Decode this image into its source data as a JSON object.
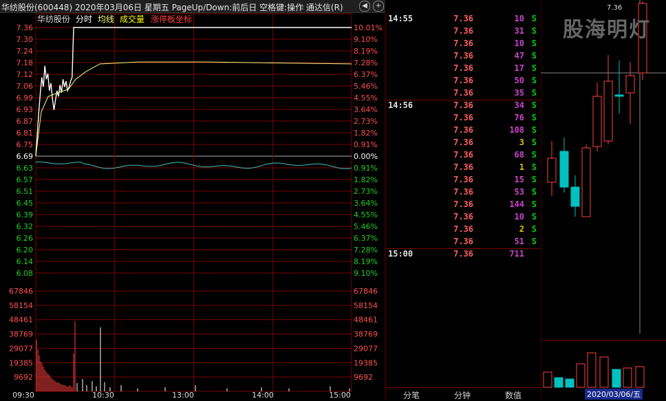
{
  "window": {
    "title": "华纺股份(600448)  2020年03月06日 星期五 PageUp/Down:前后日 空格键:操作 通达信(R)"
  },
  "legend": {
    "stock": "华纺股份",
    "items": [
      "分时",
      "均线",
      "成交量",
      "涨停板坐标"
    ]
  },
  "colors": {
    "up": "#ff4040",
    "down": "#00c0c0",
    "price_line": "#ffffff",
    "avg_line": "#ffff80",
    "grid": "#7a0000"
  },
  "price_axis": {
    "prev_close": "6.69",
    "left_labels": [
      "7.36",
      "7.30",
      "7.24",
      "7.18",
      "7.12",
      "7.06",
      "6.99",
      "6.93",
      "6.87",
      "6.81",
      "6.75",
      "6.69",
      "6.63",
      "6.57",
      "6.51",
      "6.45",
      "6.39",
      "6.32",
      "6.26",
      "6.20",
      "6.14",
      "6.08"
    ],
    "right_labels": [
      "10.01%",
      "9.10%",
      "8.19%",
      "7.28%",
      "6.37%",
      "5.46%",
      "4.55%",
      "3.64%",
      "2.73%",
      "1.82%",
      "0.91%",
      "0.00%",
      "0.91%",
      "1.82%",
      "2.73%",
      "3.64%",
      "4.55%",
      "5.46%",
      "6.37%",
      "7.28%",
      "8.19%",
      "9.10%"
    ]
  },
  "volume_axis": {
    "labels": [
      "67846",
      "58154",
      "48461",
      "38769",
      "29077",
      "19385",
      "9692"
    ]
  },
  "time_axis": {
    "labels": [
      "09:30",
      "10:30",
      "13:00",
      "14:00",
      "15:00"
    ]
  },
  "ticks": [
    {
      "time": "14:55",
      "price": "7.36",
      "vol": "10",
      "bs": "S"
    },
    {
      "time": "",
      "price": "7.36",
      "vol": "31",
      "bs": "S"
    },
    {
      "time": "",
      "price": "7.36",
      "vol": "10",
      "bs": "S"
    },
    {
      "time": "",
      "price": "7.36",
      "vol": "47",
      "bs": "S"
    },
    {
      "time": "",
      "price": "7.36",
      "vol": "17",
      "bs": "S"
    },
    {
      "time": "",
      "price": "7.36",
      "vol": "50",
      "bs": "S"
    },
    {
      "time": "",
      "price": "7.36",
      "vol": "35",
      "bs": "S"
    },
    {
      "time": "14:56",
      "price": "7.36",
      "vol": "34",
      "bs": "S"
    },
    {
      "time": "",
      "price": "7.36",
      "vol": "76",
      "bs": "S"
    },
    {
      "time": "",
      "price": "7.36",
      "vol": "108",
      "bs": "S"
    },
    {
      "time": "",
      "price": "7.36",
      "vol": "3",
      "bs": "S"
    },
    {
      "time": "",
      "price": "7.36",
      "vol": "68",
      "bs": "S"
    },
    {
      "time": "",
      "price": "7.36",
      "vol": "1",
      "bs": "S"
    },
    {
      "time": "",
      "price": "7.36",
      "vol": "15",
      "bs": "S"
    },
    {
      "time": "",
      "price": "7.36",
      "vol": "53",
      "bs": "S"
    },
    {
      "time": "",
      "price": "7.36",
      "vol": "144",
      "bs": "S"
    },
    {
      "time": "",
      "price": "7.36",
      "vol": "10",
      "bs": "S"
    },
    {
      "time": "",
      "price": "7.36",
      "vol": "2",
      "bs": "S"
    },
    {
      "time": "",
      "price": "7.36",
      "vol": "51",
      "bs": "S"
    },
    {
      "time": "15:00",
      "price": "7.36",
      "vol": "711",
      "bs": ""
    }
  ],
  "tabs": [
    "分笔",
    "分钟",
    "数值"
  ],
  "kline": {
    "watermark": "股海明灯",
    "last_price": "7.36",
    "date_label": "2020/03/06/五"
  }
}
